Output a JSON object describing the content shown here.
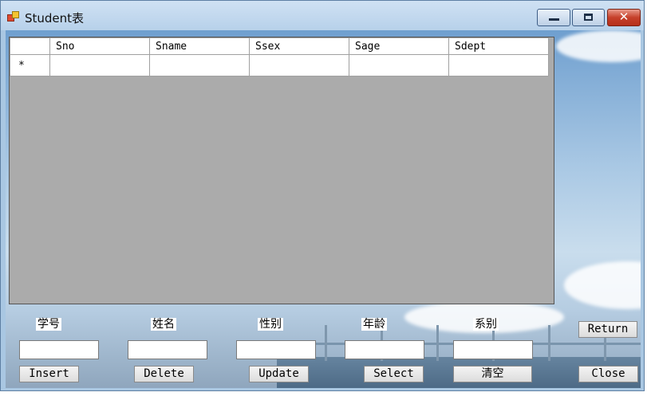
{
  "window": {
    "title": "Student表",
    "controls": {
      "minimize_icon": "minimize-icon",
      "maximize_icon": "maximize-icon",
      "close_icon": "close-icon",
      "close_color": "#c6402a"
    }
  },
  "grid": {
    "columns": [
      "Sno",
      "Sname",
      "Ssex",
      "Sage",
      "Sdept"
    ],
    "new_row_marker": "*",
    "background": "#ababab"
  },
  "form": {
    "labels": {
      "sno": "学号",
      "sname": "姓名",
      "ssex": "性别",
      "sage": "年龄",
      "sdept": "系别"
    },
    "values": {
      "sno": "",
      "sname": "",
      "ssex": "",
      "sage": "",
      "sdept": ""
    }
  },
  "buttons": {
    "return": "Return",
    "insert": "Insert",
    "delete": "Delete",
    "update": "Update",
    "select": "Select",
    "clear": "清空",
    "close": "Close"
  }
}
